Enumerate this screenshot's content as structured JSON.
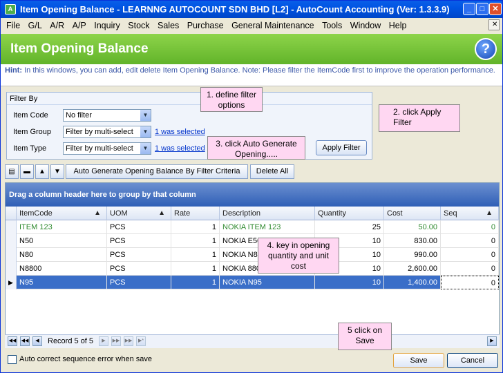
{
  "window": {
    "title": "Item Opening Balance - LEARNNG AUTOCOUNT SDN BHD [L2] - AutoCount Accounting (Ver: 1.3.3.9)"
  },
  "menu": [
    "File",
    "G/L",
    "A/R",
    "A/P",
    "Inquiry",
    "Stock",
    "Sales",
    "Purchase",
    "General Maintenance",
    "Tools",
    "Window",
    "Help"
  ],
  "header": {
    "title": "Item Opening Balance",
    "help": "?"
  },
  "hint": {
    "label": "Hint:",
    "text": "In this windows, you can add, edit  delete Item Opening Balance. Note: Please filter the ItemCode first to improve the operation performance."
  },
  "filter": {
    "title": "Filter By",
    "item_code_label": "Item Code",
    "item_code_value": "No filter",
    "item_group_label": "Item Group",
    "item_group_value": "Filter by multi-select",
    "item_group_link": "1 was selected",
    "item_type_label": "Item Type",
    "item_type_value": "Filter by multi-select",
    "item_type_link": "1 was selected",
    "apply": "Apply Filter"
  },
  "callouts": {
    "c1": "1. define filter options",
    "c2": "2. click Apply Filter",
    "c3": "3. click Auto Generate Opening.....",
    "c4": "4. key in opening quantity and unit cost",
    "c5": "5 click on Save"
  },
  "toolbar": {
    "auto_generate": "Auto Generate Opening Balance By Filter Criteria",
    "delete_all": "Delete All"
  },
  "grid": {
    "group_hint": "Drag a column header here to group by that column",
    "columns": [
      "ItemCode",
      "UOM",
      "Rate",
      "Description",
      "Quantity",
      "Cost",
      "Seq"
    ],
    "rows": [
      {
        "item": "ITEM 123",
        "uom": "PCS",
        "rate": "1",
        "desc": "NOKIA ITEM 123",
        "qty": "25",
        "cost": "50.00",
        "seq": "0"
      },
      {
        "item": "N50",
        "uom": "PCS",
        "rate": "1",
        "desc": "NOKIA E50",
        "qty": "10",
        "cost": "830.00",
        "seq": "0"
      },
      {
        "item": "N80",
        "uom": "PCS",
        "rate": "1",
        "desc": "NOKIA N80",
        "qty": "10",
        "cost": "990.00",
        "seq": "0"
      },
      {
        "item": "N8800",
        "uom": "PCS",
        "rate": "1",
        "desc": "NOKIA 8800",
        "qty": "10",
        "cost": "2,600.00",
        "seq": "0"
      },
      {
        "item": "N95",
        "uom": "PCS",
        "rate": "1",
        "desc": "NOKIA N95",
        "qty": "10",
        "cost": "1,400.00",
        "seq": "0"
      }
    ],
    "record": "Record 5 of 5"
  },
  "footer": {
    "auto_correct": "Auto correct sequence error when save",
    "save": "Save",
    "cancel": "Cancel"
  }
}
